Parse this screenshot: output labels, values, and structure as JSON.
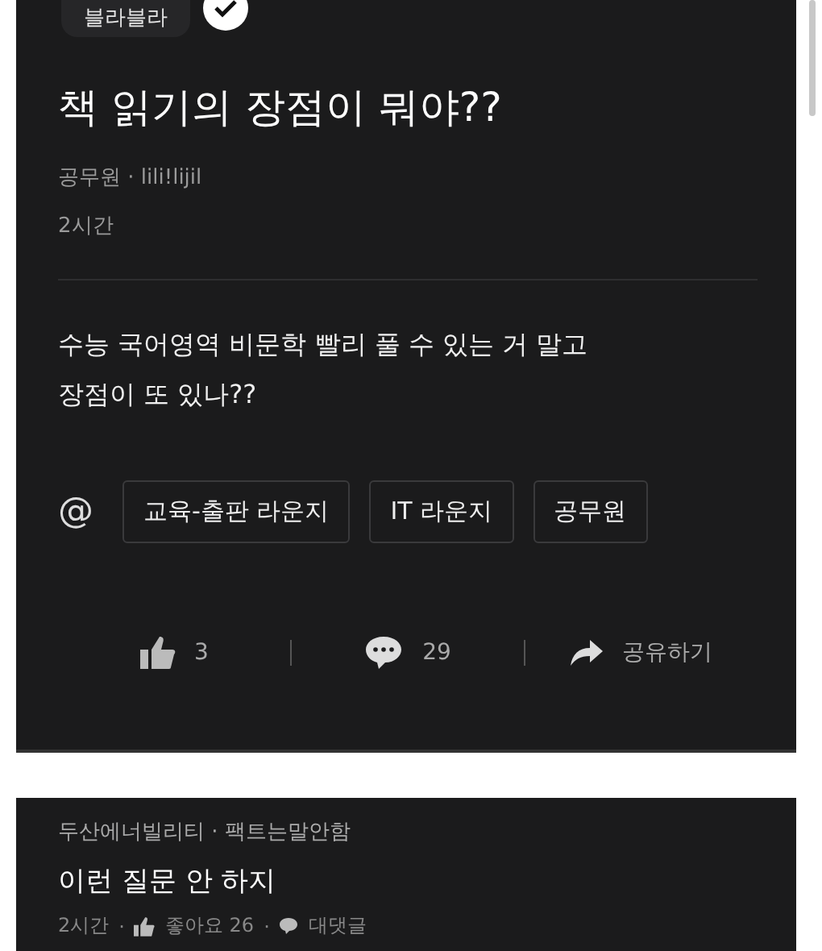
{
  "separator": "·",
  "post": {
    "board": "블라블라",
    "verified": true,
    "title": "책 읽기의 장점이 뭐야??",
    "company": "공무원",
    "author": "lili!lijil",
    "time": "2시간",
    "body": [
      "수능 국어영역 비문학 빨리 풀 수 있는 거 말고",
      "장점이 또 있나??"
    ],
    "mention_symbol": "@",
    "tags": [
      "교육-출판 라운지",
      "IT 라운지",
      "공무원"
    ],
    "actions": [
      {
        "kind": "like",
        "label": "3"
      },
      {
        "kind": "comment",
        "label": "29"
      },
      {
        "kind": "share",
        "label": "공유하기"
      }
    ]
  },
  "comment": {
    "company": "두산에너빌리티",
    "author": "팩트는말안함",
    "text": "이런 질문 안 하지",
    "time": "2시간",
    "likes": "좋아요 26",
    "reply": "대댓글"
  }
}
